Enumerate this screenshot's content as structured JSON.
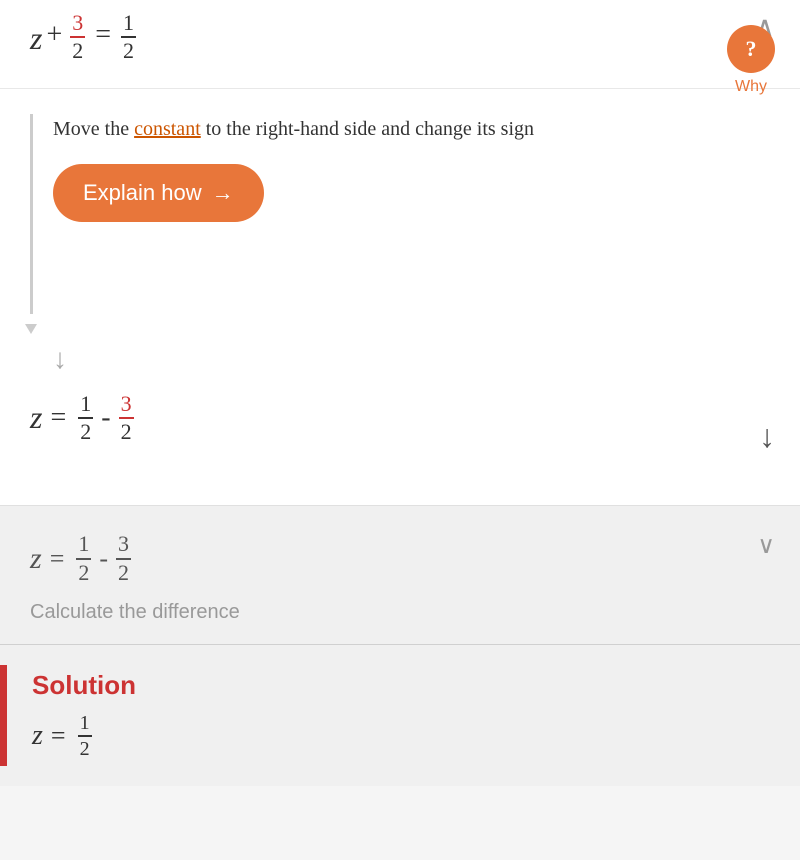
{
  "top": {
    "equation": {
      "z": "z",
      "plus": "+",
      "fraction1_num": "3",
      "fraction1_den": "2",
      "equals": "=",
      "fraction2_num": "1",
      "fraction2_den": "2"
    }
  },
  "explanation": {
    "text_before": "Move the ",
    "constant_word": "constant",
    "text_after": " to the right-hand side and change its sign",
    "why_label": "Why",
    "why_symbol": "?",
    "explain_button_label": "Explain how",
    "explain_button_arrow": "→"
  },
  "result": {
    "z": "z",
    "equals": "=",
    "fraction1_num": "1",
    "fraction1_den": "2",
    "minus": "-",
    "fraction2_num": "3",
    "fraction2_den": "2"
  },
  "bottom": {
    "equation": {
      "z": "z",
      "equals": "=",
      "fraction1_num": "1",
      "fraction1_den": "2",
      "minus": "-",
      "fraction2_num": "3",
      "fraction2_den": "2"
    },
    "calculate_text": "Calculate the difference"
  },
  "solution": {
    "label": "Solution",
    "z": "z",
    "equals": "=",
    "fraction_num": "1",
    "fraction_den": "2"
  }
}
